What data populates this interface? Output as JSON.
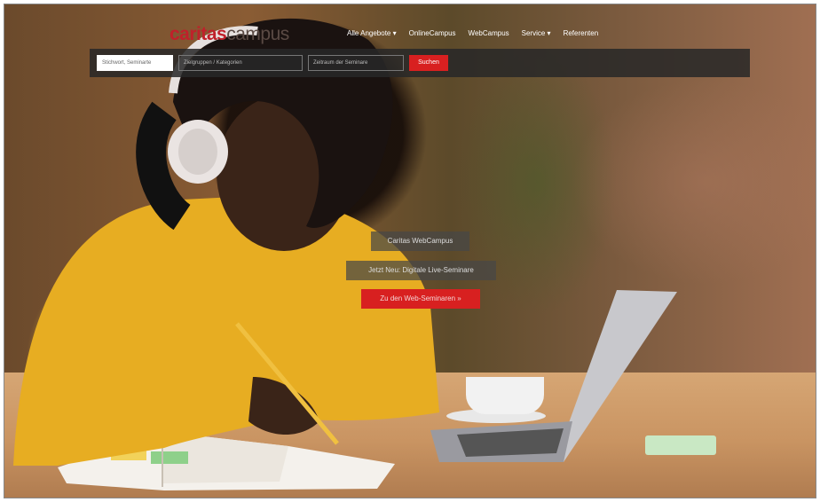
{
  "logo": {
    "caritas": "caritas",
    "campus": "campus"
  },
  "menu": [
    "Alle Angebote ▾",
    "OnlineCampus",
    "WebCampus",
    "Service ▾",
    "Referenten"
  ],
  "search": {
    "field1_placeholder": "Stichwort, Seminarte",
    "field2_placeholder": "Zielgruppen / Kategorien",
    "field3_placeholder": "Zeitraum der Seminare",
    "button": "Suchen"
  },
  "hero": {
    "tag1": "Caritas WebCampus",
    "tag2": "Jetzt Neu: Digitale Live-Seminare",
    "button": "Zu den Web-Seminaren »"
  },
  "colors": {
    "accent": "#d82020",
    "logo_red": "#c0202a"
  }
}
